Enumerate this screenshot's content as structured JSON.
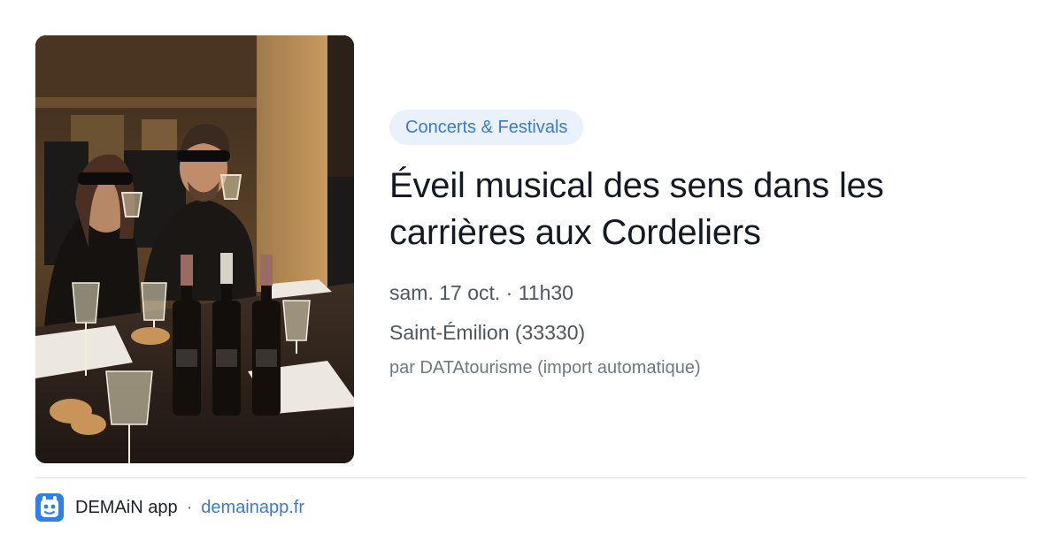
{
  "event": {
    "category": "Concerts & Festivals",
    "title": "Éveil musical des sens dans les carrières aux Cordeliers",
    "date": "sam. 17 oct. · 11h30",
    "location": "Saint-Émilion (33330)",
    "source": "par DATAtourisme (import automatique)"
  },
  "footer": {
    "app_name": "DEMAiN app",
    "separator": "·",
    "site": "demainapp.fr"
  },
  "colors": {
    "accent": "#3a7ad0",
    "tag_background": "#e8f1fc",
    "title": "#141a24",
    "app_icon": "#2f80e6"
  },
  "icons": {
    "app": "demain-app-icon"
  }
}
